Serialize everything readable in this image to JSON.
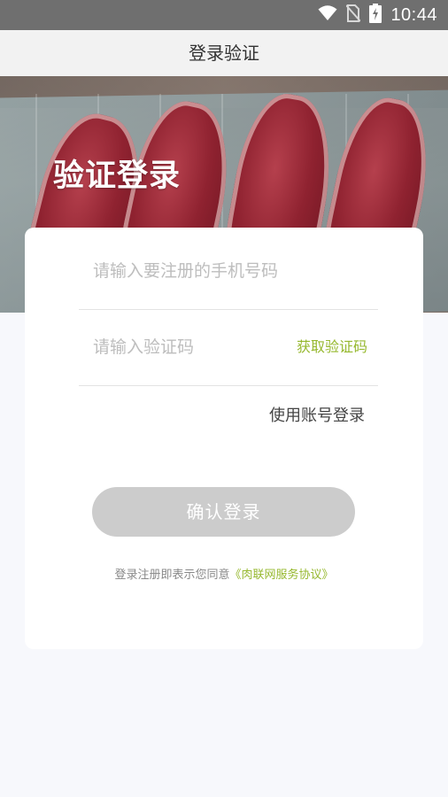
{
  "status_bar": {
    "time": "10:44"
  },
  "navbar": {
    "title": "登录验证"
  },
  "hero": {
    "title": "验证登录"
  },
  "form": {
    "phone_placeholder": "请输入要注册的手机号码",
    "code_placeholder": "请输入验证码",
    "get_code_label": "获取验证码",
    "account_login_label": "使用账号登录",
    "confirm_label": "确认登录"
  },
  "agreement": {
    "prefix": "登录注册即表示您同意",
    "link_label": "《肉联网服务协议》"
  },
  "colors": {
    "accent": "#96b82e",
    "button_disabled": "#cccccc",
    "status_bar": "#6f6f6f"
  }
}
